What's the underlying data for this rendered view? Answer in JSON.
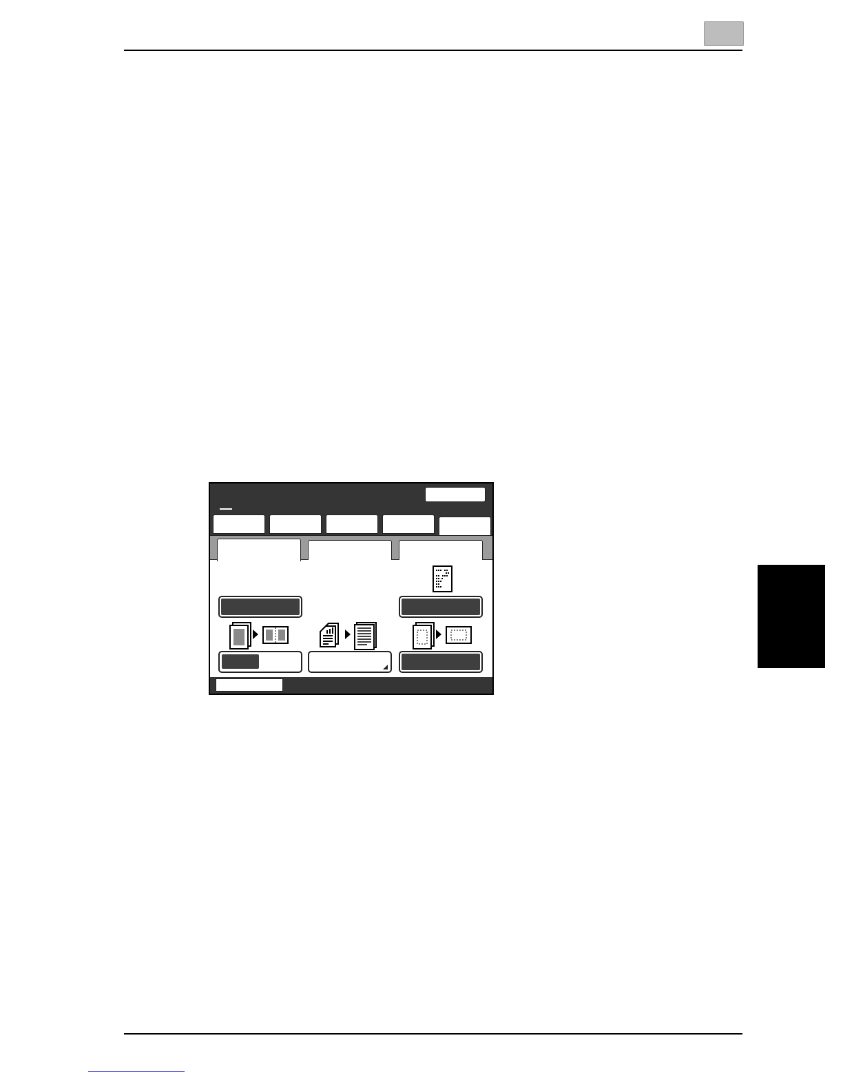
{
  "page": {
    "chapter_marker": "",
    "side_tab_label": ""
  },
  "screen": {
    "title": "",
    "top_right_button": "",
    "top_tabs": [
      "",
      "",
      "",
      "",
      ""
    ],
    "active_top_tab": 4,
    "sub_tabs": [
      "",
      "",
      ""
    ],
    "active_sub_tab": 0,
    "buttons": {
      "left_upper": "",
      "right_upper": "",
      "left_lower": "",
      "middle_lower": "",
      "right_lower": ""
    },
    "icons": {
      "document_icon": "document-icon",
      "book_copy_icon": "book-copy-icon",
      "multi_page_icon": "multi-page-to-single-icon",
      "frame_erase_icon": "frame-erase-icon"
    },
    "status_box": ""
  },
  "colors": {
    "screen_dark": "#353535",
    "button_fill": "#3f3f3f",
    "subtab_strip": "#9c9c9c",
    "chapter_box": "#bdbdbd",
    "link_underline": "#4a4ad8"
  }
}
